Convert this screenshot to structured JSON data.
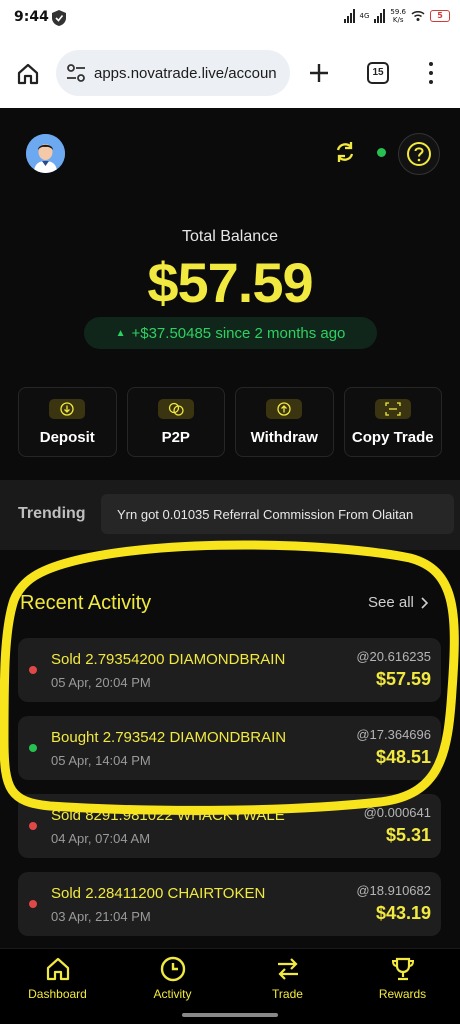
{
  "status_bar": {
    "time": "9:44",
    "net_speed": "59.6",
    "net_unit": "K/s",
    "network_type": "4G",
    "battery": "5"
  },
  "browser": {
    "url": "apps.novatrade.live/accoun",
    "tab_count": "15"
  },
  "header": {
    "online_color": "#27c152"
  },
  "balance": {
    "label": "Total Balance",
    "value": "$57.59",
    "change": "+$37.50485 since 2 months ago"
  },
  "actions": [
    {
      "label": "Deposit",
      "icon": "arrow-down-icon"
    },
    {
      "label": "P2P",
      "icon": "coins-icon"
    },
    {
      "label": "Withdraw",
      "icon": "arrow-up-icon"
    },
    {
      "label": "Copy Trade",
      "icon": "scan-icon"
    }
  ],
  "trending": {
    "label": "Trending",
    "ticker": "Yrn got 0.01035 Referral Commission From Olaitan"
  },
  "recent": {
    "title": "Recent Activity",
    "see_all": "See all",
    "items": [
      {
        "title": "Sold 2.79354200 DIAMONDBRAIN",
        "date": "05 Apr, 20:04 PM",
        "rate": "@20.616235",
        "amount": "$57.59",
        "status": "sell"
      },
      {
        "title": "Bought 2.793542 DIAMONDBRAIN",
        "date": "05 Apr, 14:04 PM",
        "rate": "@17.364696",
        "amount": "$48.51",
        "status": "buy"
      },
      {
        "title": "Sold 8291.981022 WHACKYWALE",
        "date": "04 Apr, 07:04 AM",
        "rate": "@0.000641",
        "amount": "$5.31",
        "status": "sell"
      },
      {
        "title": "Sold 2.28411200 CHAIRTOKEN",
        "date": "03 Apr, 21:04 PM",
        "rate": "@18.910682",
        "amount": "$43.19",
        "status": "sell"
      }
    ]
  },
  "colors": {
    "accent": "#f2e940",
    "sell": "#e04848",
    "buy": "#27c152"
  },
  "nav": [
    {
      "label": "Dashboard",
      "icon": "home-icon"
    },
    {
      "label": "Activity",
      "icon": "clock-icon"
    },
    {
      "label": "Trade",
      "icon": "swap-icon"
    },
    {
      "label": "Rewards",
      "icon": "trophy-icon"
    }
  ]
}
